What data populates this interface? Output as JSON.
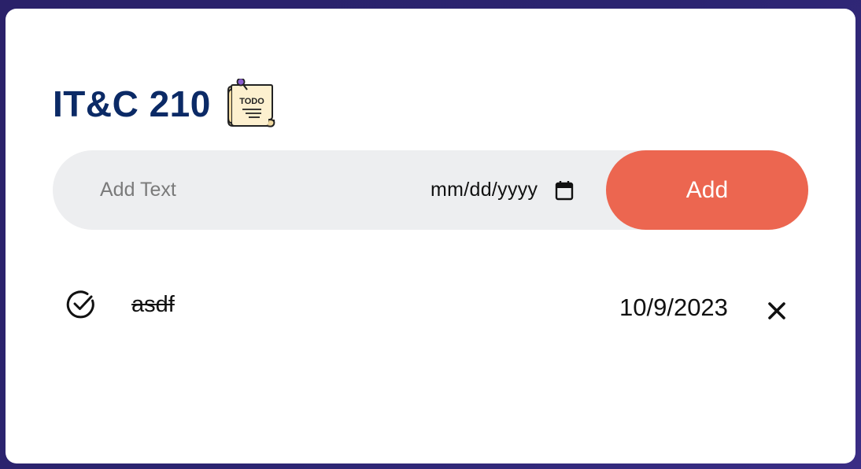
{
  "header": {
    "title": "IT&C 210",
    "icon": "todo-note-icon",
    "icon_text": "TODO"
  },
  "form": {
    "text_placeholder": "Add Text",
    "date_placeholder": "mm/dd/yyyy",
    "date_icon": "calendar-icon",
    "add_label": "Add",
    "add_color": "#ec6650",
    "bar_color": "#edeef0"
  },
  "todos": [
    {
      "text": "asdf",
      "date": "10/9/2023",
      "completed": true,
      "status_icon": "check-circle-icon",
      "delete_icon": "close-icon"
    }
  ],
  "colors": {
    "title": "#0b2a66",
    "background": "#2a2169",
    "card": "#ffffff"
  }
}
